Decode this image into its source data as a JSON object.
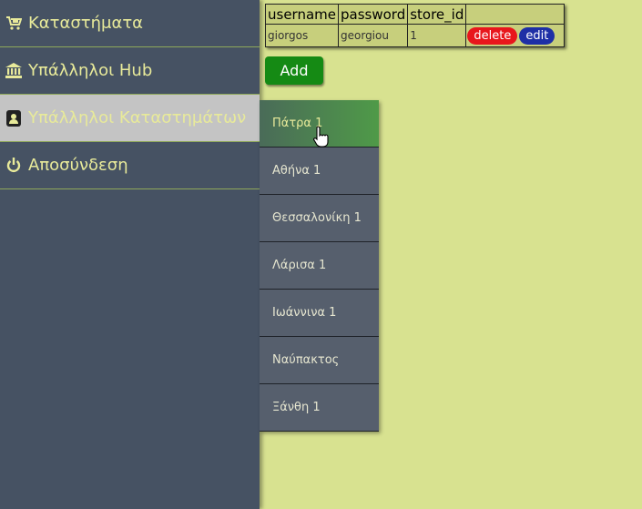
{
  "sidebar": {
    "items": [
      {
        "label": "Καταστήματα",
        "icon": "cart-icon"
      },
      {
        "label": "Υπάλληλοι Hub",
        "icon": "bank-icon"
      },
      {
        "label": "Υπάλληλοι Καταστημάτων",
        "icon": "contact-card-icon"
      },
      {
        "label": "Αποσύνδεση",
        "icon": "power-icon"
      }
    ]
  },
  "submenu": {
    "items": [
      {
        "label": "Πάτρα 1"
      },
      {
        "label": "Αθήνα 1"
      },
      {
        "label": "Θεσσαλονίκη 1"
      },
      {
        "label": "Λάρισα 1"
      },
      {
        "label": "Ιωάννινα 1"
      },
      {
        "label": "Ναύπακτος"
      },
      {
        "label": "Ξάνθη 1"
      }
    ]
  },
  "table": {
    "headers": [
      "username",
      "password",
      "store_id",
      ""
    ],
    "rows": [
      {
        "username": "giorgos",
        "password": "georgiou",
        "store_id": "1",
        "delete_label": "delete",
        "edit_label": "edit"
      }
    ]
  },
  "add_label": "Add",
  "colors": {
    "background": "#d8e290",
    "sidebar": "#465263",
    "nav_text": "#e8ea9a",
    "active_nav": "#c4c4c4",
    "submenu": "#565f6d",
    "delete": "#e8161c",
    "edit": "#1e2fa6",
    "add": "#158a14"
  }
}
